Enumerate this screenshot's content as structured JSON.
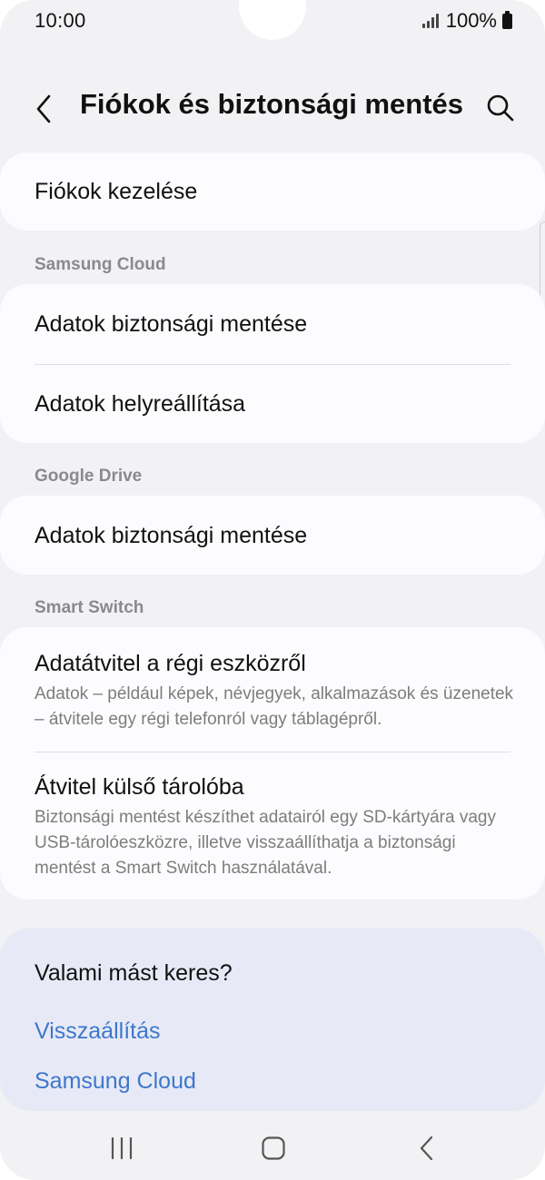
{
  "status_bar": {
    "time": "10:00",
    "battery": "100%"
  },
  "header": {
    "title": "Fiókok és biztonsági mentés"
  },
  "items": {
    "manage_accounts": "Fiókok kezelése",
    "samsung_cloud_label": "Samsung Cloud",
    "sc_backup": "Adatok biztonsági mentése",
    "sc_restore": "Adatok helyreállítása",
    "google_drive_label": "Google Drive",
    "gd_backup": "Adatok biztonsági mentése",
    "smart_switch_label": "Smart Switch",
    "ss_transfer_title": "Adatátvitel a régi eszközről",
    "ss_transfer_sub": "Adatok – például képek, névjegyek, alkalmazások és üzenetek – átvitele egy régi telefonról vagy táblagépről.",
    "ss_external_title": "Átvitel külső tárolóba",
    "ss_external_sub": "Biztonsági mentést készíthet adatairól egy SD-kártyára vagy USB-tárolóeszközre, illetve visszaállíthatja a biztonsági mentést a Smart Switch használatával."
  },
  "suggestions": {
    "title": "Valami mást keres?",
    "links": [
      "Visszaállítás",
      "Samsung Cloud"
    ]
  },
  "colors": {
    "background": "#f2f2f4",
    "card": "#fcfcfe",
    "suggest_bg": "#e7eaf6",
    "link": "#3e77cc",
    "secondary_text": "#7d7d7d"
  }
}
